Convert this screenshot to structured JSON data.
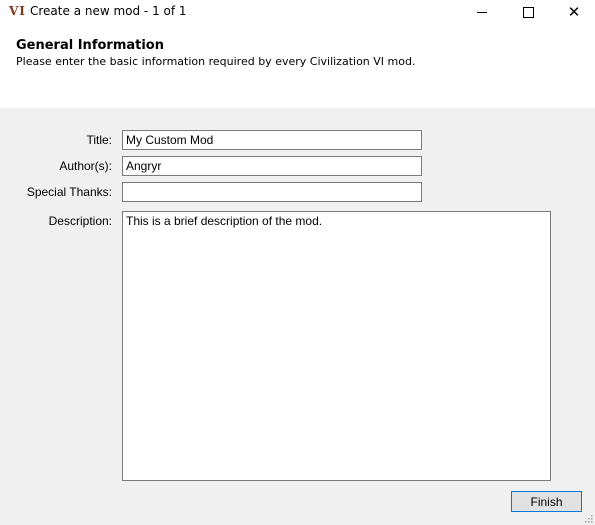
{
  "window": {
    "app_icon_text": "VI",
    "title": "Create a new mod - 1 of 1",
    "minimize_icon": "minimize-icon",
    "maximize_icon": "maximize-icon",
    "close_icon": "close-icon",
    "close_glyph": "✕"
  },
  "header": {
    "title": "General Information",
    "subtitle": "Please enter the basic information required by every Civilization VI mod."
  },
  "form": {
    "title": {
      "label": "Title:",
      "value": "My Custom Mod"
    },
    "authors": {
      "label": "Author(s):",
      "value": "Angryr"
    },
    "special_thanks": {
      "label": "Special Thanks:",
      "value": ""
    },
    "description": {
      "label": "Description:",
      "value": "This is a brief description of the mod."
    }
  },
  "buttons": {
    "finish_label": "Finish"
  },
  "colors": {
    "content_background": "#f0f0f0",
    "accent": "#0078d7",
    "app_icon": "#7a3a18"
  }
}
